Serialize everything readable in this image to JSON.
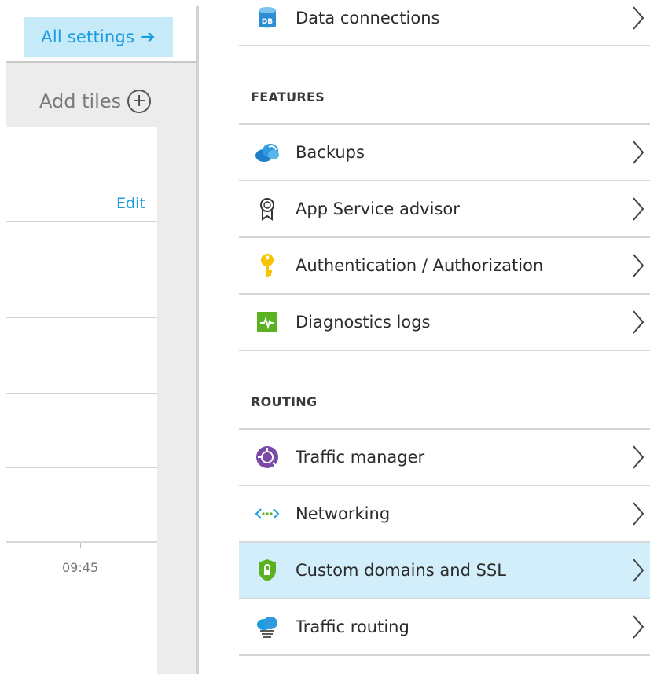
{
  "left_blade": {
    "all_settings_label": "All settings",
    "add_tiles_label": "Add tiles",
    "edit_label": "Edit",
    "axis_label": "09:45"
  },
  "menu": {
    "top_items": [
      {
        "label": "Data connections",
        "icon": "database-icon"
      }
    ],
    "features_header": "FEATURES",
    "features": [
      {
        "label": "Backups",
        "icon": "cloud-backup-icon"
      },
      {
        "label": "App Service advisor",
        "icon": "advisor-ribbon-icon"
      },
      {
        "label": "Authentication / Authorization",
        "icon": "key-icon"
      },
      {
        "label": "Diagnostics logs",
        "icon": "diagnostics-pulse-icon"
      }
    ],
    "routing_header": "ROUTING",
    "routing": [
      {
        "label": "Traffic manager",
        "icon": "traffic-manager-icon"
      },
      {
        "label": "Networking",
        "icon": "networking-icon"
      },
      {
        "label": "Custom domains and SSL",
        "icon": "ssl-shield-icon",
        "selected": true
      },
      {
        "label": "Traffic routing",
        "icon": "traffic-routing-icon"
      }
    ]
  },
  "colors": {
    "accent_blue": "#1a9ce0",
    "selected_row": "#d2eefb",
    "all_settings_bg": "#c7eaf9"
  }
}
